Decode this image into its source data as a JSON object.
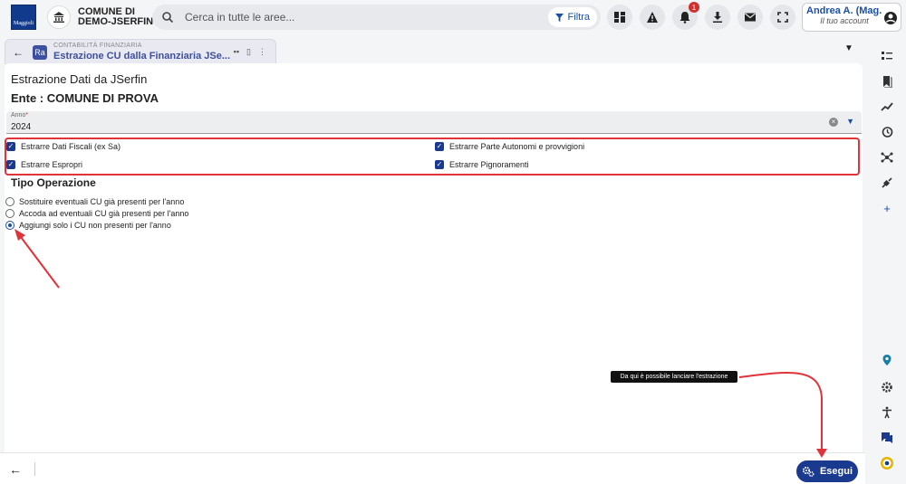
{
  "header": {
    "logo_text": "Maggioli",
    "ente_name_line1": "COMUNE DI",
    "ente_name_line2": "DEMO-JSERFIN",
    "search_placeholder": "Cerca in tutte le aree...",
    "filter_label": "Filtra",
    "notification_count": "1",
    "user_name": "Andrea A. (Mag...",
    "user_sub": "Il tuo account"
  },
  "tab": {
    "category": "CONTABILITÀ FINANZIARIA",
    "title": "Estrazione CU dalla Finanziaria JSe...",
    "icon_text": "Ra"
  },
  "form": {
    "title": "Estrazione Dati da JSerfin",
    "ente": "Ente : COMUNE DI PROVA",
    "anno_label": "Anno",
    "anno_required": "*",
    "anno_value": "2024",
    "checkboxes": [
      {
        "label": "Estrarre Dati Fiscali (ex Sa)",
        "checked": true
      },
      {
        "label": "Estrarre Parte Autonomi e provvigioni",
        "checked": true
      },
      {
        "label": "Estrarre Espropri",
        "checked": true
      },
      {
        "label": "Estrarre Pignoramenti",
        "checked": true
      }
    ],
    "tipo_operazione_title": "Tipo Operazione",
    "radios": [
      {
        "label": "Sostituire eventuali CU già presenti per l'anno",
        "selected": false
      },
      {
        "label": "Accoda ad eventuali CU già presenti per l'anno",
        "selected": false
      },
      {
        "label": "Aggiungi solo i CU non presenti per l'anno",
        "selected": true
      }
    ]
  },
  "footer": {
    "execute_label": "Esegui"
  },
  "annotations": {
    "tooltip_text": "Da qui è possibile lanciare l'estrazione",
    "highlight_color": "#e0333a"
  },
  "colors": {
    "accent": "#1a3a8f",
    "brand_blue": "#1a4fa8",
    "badge_red": "#d32f2f"
  }
}
